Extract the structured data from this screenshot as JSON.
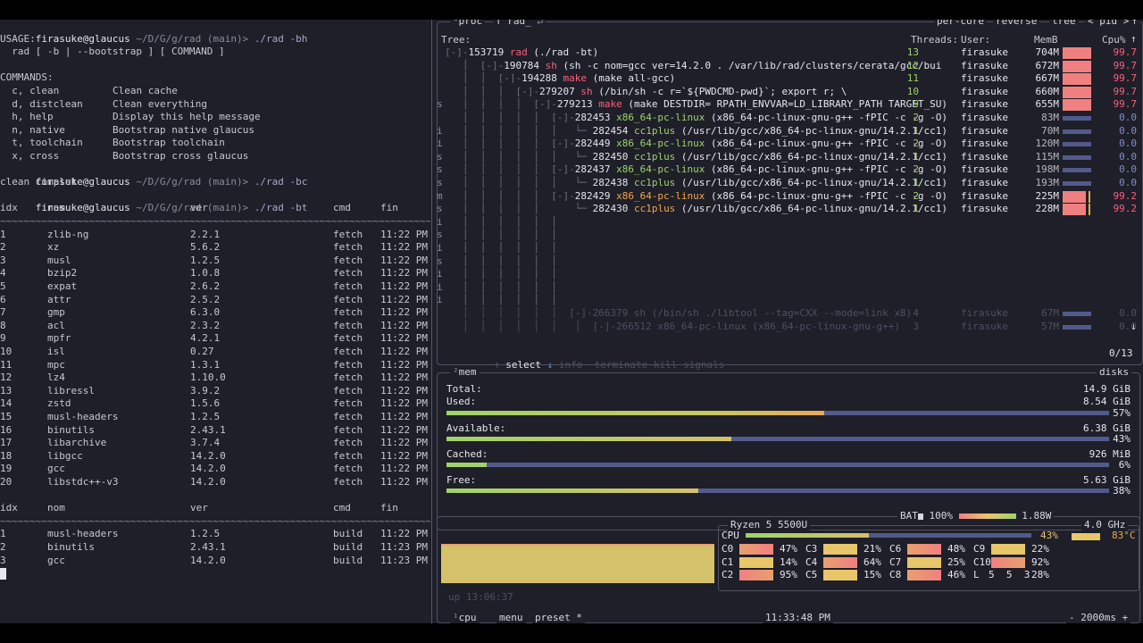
{
  "terminal": {
    "prompt_user": "firasuke@glaucus",
    "prompt_path": " ~/D/G/g/rad",
    "prompt_branch": " (main)> ",
    "cmd1": "./rad -bh",
    "usage_label": "USAGE:",
    "usage_line": "  rad [ -b | --bootstrap ] [ COMMAND ]",
    "commands_label": "COMMANDS:",
    "commands": [
      {
        "key": "  c, clean",
        "desc": "Clean cache"
      },
      {
        "key": "  d, distclean",
        "desc": "Clean everything"
      },
      {
        "key": "  h, help",
        "desc": "Display this help message"
      },
      {
        "key": "  n, native",
        "desc": "Bootstrap native glaucus"
      },
      {
        "key": "  t, toolchain",
        "desc": "Bootstrap toolchain"
      },
      {
        "key": "  x, cross",
        "desc": "Bootstrap cross glaucus"
      }
    ],
    "cmd2": "./rad -bc",
    "clean_msg": "clean complete",
    "cmd3": "./rad -bt",
    "table_headers": {
      "idx": "idx",
      "nom": "nom",
      "ver": "ver",
      "cmd": "cmd",
      "fin": "fin"
    },
    "separator": "~~~~~~~~~~~~~~~~~~~~~~~~~~~~~~~~~~~~~~~~~~~~~~~~~~~~~~~~~~~~~~~~~~~~~~~~~~~~~~~~~~~~~~~~~~~~~~~~",
    "fetch_rows": [
      [
        "1",
        "zlib-ng",
        "2.2.1",
        "fetch",
        "11:22 PM"
      ],
      [
        "2",
        "xz",
        "5.6.2",
        "fetch",
        "11:22 PM"
      ],
      [
        "3",
        "musl",
        "1.2.5",
        "fetch",
        "11:22 PM"
      ],
      [
        "4",
        "bzip2",
        "1.0.8",
        "fetch",
        "11:22 PM"
      ],
      [
        "5",
        "expat",
        "2.6.2",
        "fetch",
        "11:22 PM"
      ],
      [
        "6",
        "attr",
        "2.5.2",
        "fetch",
        "11:22 PM"
      ],
      [
        "7",
        "gmp",
        "6.3.0",
        "fetch",
        "11:22 PM"
      ],
      [
        "8",
        "acl",
        "2.3.2",
        "fetch",
        "11:22 PM"
      ],
      [
        "9",
        "mpfr",
        "4.2.1",
        "fetch",
        "11:22 PM"
      ],
      [
        "10",
        "isl",
        "0.27",
        "fetch",
        "11:22 PM"
      ],
      [
        "11",
        "mpc",
        "1.3.1",
        "fetch",
        "11:22 PM"
      ],
      [
        "12",
        "lz4",
        "1.10.0",
        "fetch",
        "11:22 PM"
      ],
      [
        "13",
        "libressl",
        "3.9.2",
        "fetch",
        "11:22 PM"
      ],
      [
        "14",
        "zstd",
        "1.5.6",
        "fetch",
        "11:22 PM"
      ],
      [
        "15",
        "musl-headers",
        "1.2.5",
        "fetch",
        "11:22 PM"
      ],
      [
        "16",
        "binutils",
        "2.43.1",
        "fetch",
        "11:22 PM"
      ],
      [
        "17",
        "libarchive",
        "3.7.4",
        "fetch",
        "11:22 PM"
      ],
      [
        "18",
        "libgcc",
        "14.2.0",
        "fetch",
        "11:22 PM"
      ],
      [
        "19",
        "gcc",
        "14.2.0",
        "fetch",
        "11:22 PM"
      ],
      [
        "20",
        "libstdc++-v3",
        "14.2.0",
        "fetch",
        "11:22 PM"
      ]
    ],
    "build_rows": [
      [
        "1",
        "musl-headers",
        "1.2.5",
        "build",
        "11:22 PM"
      ],
      [
        "2",
        "binutils",
        "2.43.1",
        "build",
        "11:23 PM"
      ],
      [
        "3",
        "gcc",
        "14.2.0",
        "build",
        "11:23 PM"
      ]
    ]
  },
  "btop": {
    "proc": {
      "title_num": "⁴",
      "title": "proc",
      "filter": "f rad_",
      "filter_icon": "↵",
      "opts": [
        "per-core",
        "reverse",
        "tree",
        "< pid >"
      ],
      "header_left": "Tree:",
      "header_threads": "Threads:",
      "header_user": "User:",
      "header_mem": "MemB",
      "header_cpu": "Cpu%",
      "rows": [
        {
          "st": "",
          "tree": "[-]-",
          "pid": "153719",
          "name": "rad",
          "cmd": " (./rad -bt)",
          "thr": "13",
          "user": "firasuke",
          "mem": "704M",
          "cpu": "99.7",
          "hot": true
        },
        {
          "st": "",
          "tree": "   │  [-]-",
          "pid": "190784",
          "name": "sh",
          "cmd": " (sh -c nom=gcc ver=14.2.0 . /var/lib/rad/clusters/cerata/gcc/bui",
          "thr": "12",
          "user": "firasuke",
          "mem": "672M",
          "cpu": "99.7",
          "hot": true
        },
        {
          "st": "",
          "tree": "   │  │  [-]-",
          "pid": "194288",
          "name": "make",
          "cmd": " (make all-gcc)",
          "thr": "11",
          "user": "firasuke",
          "mem": "667M",
          "cpu": "99.7",
          "hot": true
        },
        {
          "st": "",
          "tree": "   │  │  │  [-]-",
          "pid": "279207",
          "name": "sh",
          "cmd": " (/bin/sh -c r=`${PWDCMD-pwd}`; export r; \\",
          "thr": "10",
          "user": "firasuke",
          "mem": "660M",
          "cpu": "99.7",
          "hot": true
        },
        {
          "st": "s",
          "tree": "   │  │  │  │  [-]-",
          "pid": "279213",
          "name": "make",
          "cmd": " (make DESTDIR= RPATH_ENVVAR=LD_LIBRARY_PATH TARGET_SU)",
          "thr": "9",
          "user": "firasuke",
          "mem": "655M",
          "cpu": "99.7",
          "hot": true
        },
        {
          "st": "",
          "tree": "   │  │  │  │  │  [-]-",
          "pid": "282453",
          "name": "x86_64-pc-linux",
          "cmd": " (x86_64-pc-linux-gnu-g++ -fPIC -c -g -O)",
          "thr": "2",
          "user": "firasuke",
          "mem": "83M",
          "cpu": "0.0",
          "hot": false
        },
        {
          "st": "i",
          "tree": "   │  │  │  │  │  │   └─ ",
          "pid": "282454",
          "name": "cc1plus",
          "cmd": " (/usr/lib/gcc/x86_64-pc-linux-gnu/14.2.1/cc1)",
          "thr": "1",
          "user": "firasuke",
          "mem": "70M",
          "cpu": "0.0",
          "hot": false
        },
        {
          "st": "i",
          "tree": "   │  │  │  │  │  [-]-",
          "pid": "282449",
          "name": "x86_64-pc-linux",
          "cmd": " (x86_64-pc-linux-gnu-g++ -fPIC -c -g -O)",
          "thr": "2",
          "user": "firasuke",
          "mem": "120M",
          "cpu": "0.0",
          "hot": false
        },
        {
          "st": "s",
          "tree": "   │  │  │  │  │  │   └─ ",
          "pid": "282450",
          "name": "cc1plus",
          "cmd": " (/usr/lib/gcc/x86_64-pc-linux-gnu/14.2.1/cc1)",
          "thr": "1",
          "user": "firasuke",
          "mem": "115M",
          "cpu": "0.0",
          "hot": false
        },
        {
          "st": "s",
          "tree": "   │  │  │  │  │  [-]-",
          "pid": "282437",
          "name": "x86_64-pc-linux",
          "cmd": " (x86_64-pc-linux-gnu-g++ -fPIC -c -g -O)",
          "thr": "2",
          "user": "firasuke",
          "mem": "198M",
          "cpu": "0.0",
          "hot": false
        },
        {
          "st": "s",
          "tree": "   │  │  │  │  │  │   └─ ",
          "pid": "282438",
          "name": "cc1plus",
          "cmd": " (/usr/lib/gcc/x86_64-pc-linux-gnu/14.2.1/cc1)",
          "thr": "1",
          "user": "firasuke",
          "mem": "193M",
          "cpu": "0.0",
          "hot": false
        },
        {
          "st": "m",
          "tree": "   │  │  │  │  │  [-]-",
          "pid": "282429",
          "name": "x86_64-pc-linux",
          "cmd": " (x86_64-pc-linux-gnu-g++ -fPIC -c -g -O)",
          "thr": "2",
          "user": "firasuke",
          "mem": "225M",
          "cpu": "99.2",
          "hot": true
        },
        {
          "st": "s",
          "tree": "   │  │  │  │  │      └─ ",
          "pid": "282430",
          "name": "cc1plus",
          "cmd": " (/usr/lib/gcc/x86_64-pc-linux-gnu/14.2.1/cc1)",
          "thr": "1",
          "user": "firasuke",
          "mem": "228M",
          "cpu": "99.2",
          "hot": true
        }
      ],
      "empty_status": [
        "i",
        "s",
        "i",
        "s",
        "i",
        "i",
        "i"
      ],
      "faded_rows": [
        {
          "tree": "   │  │  │  │  │  │  [-]-",
          "pid": "266379",
          "name": "sh",
          "cmd": " (/bin/sh ./libtool --tag=CXX --mode=link x8)",
          "thr": "4",
          "user": "firasuke",
          "mem": "67M",
          "cpu": "0.0"
        },
        {
          "tree": "   │  │  │  │  │  │   │  [-]-",
          "pid": "266512",
          "name": "x86_64-pc-linux",
          "cmd": " (x86_64-pc-linux-gnu-g++)",
          "thr": "3",
          "user": "firasuke",
          "mem": "57M",
          "cpu": "0.0"
        }
      ],
      "footer": {
        "select": "select",
        "info": "info",
        "terminate": "terminate",
        "kill": "kill",
        "signals": "signals",
        "count": "0/13"
      }
    },
    "mem": {
      "title_num": "²",
      "title": "mem",
      "disks": "disks",
      "total_label": "Total:",
      "total": "14.9 GiB",
      "used_label": "Used:",
      "used": "8.54 GiB",
      "used_pct": "57%",
      "used_frac": 0.57,
      "avail_label": "Available:",
      "avail": "6.38 GiB",
      "avail_pct": "43%",
      "avail_frac": 0.43,
      "cached_label": "Cached:",
      "cached": "926 MiB",
      "cached_pct": "6%",
      "cached_frac": 0.06,
      "free_label": "Free:",
      "free": "5.63 GiB",
      "free_pct": "38%",
      "free_frac": 0.38
    },
    "cpu": {
      "title_num": "¹",
      "title": "cpu",
      "menu": "menu",
      "preset": "preset *",
      "clock": "11:33:48 PM",
      "interval": "- 2000ms +",
      "bat_label": "BAT",
      "bat_pct": "100%",
      "bat_power": "1.88W",
      "model": "Ryzen 5 5500U",
      "freq": "4.0 GHz",
      "total_label": "CPU",
      "total_pct": "43%",
      "total_frac": 0.43,
      "temp": "83°C",
      "uptime": "up 13:06:37",
      "cores": [
        {
          "label": "C0",
          "pct": "47%"
        },
        {
          "label": "C1",
          "pct": "14%"
        },
        {
          "label": "C2",
          "pct": "95%"
        },
        {
          "label": "C3",
          "pct": "21%"
        },
        {
          "label": "C4",
          "pct": "64%"
        },
        {
          "label": "C5",
          "pct": "15%"
        },
        {
          "label": "C6",
          "pct": "48%"
        },
        {
          "label": "C7",
          "pct": "25%"
        },
        {
          "label": "C8",
          "pct": "46%"
        },
        {
          "label": "C9",
          "pct": "22%"
        },
        {
          "label": "C10",
          "pct": "92%"
        },
        {
          "label": "L",
          "pct": "28%"
        }
      ],
      "load": "5  5  3"
    }
  }
}
